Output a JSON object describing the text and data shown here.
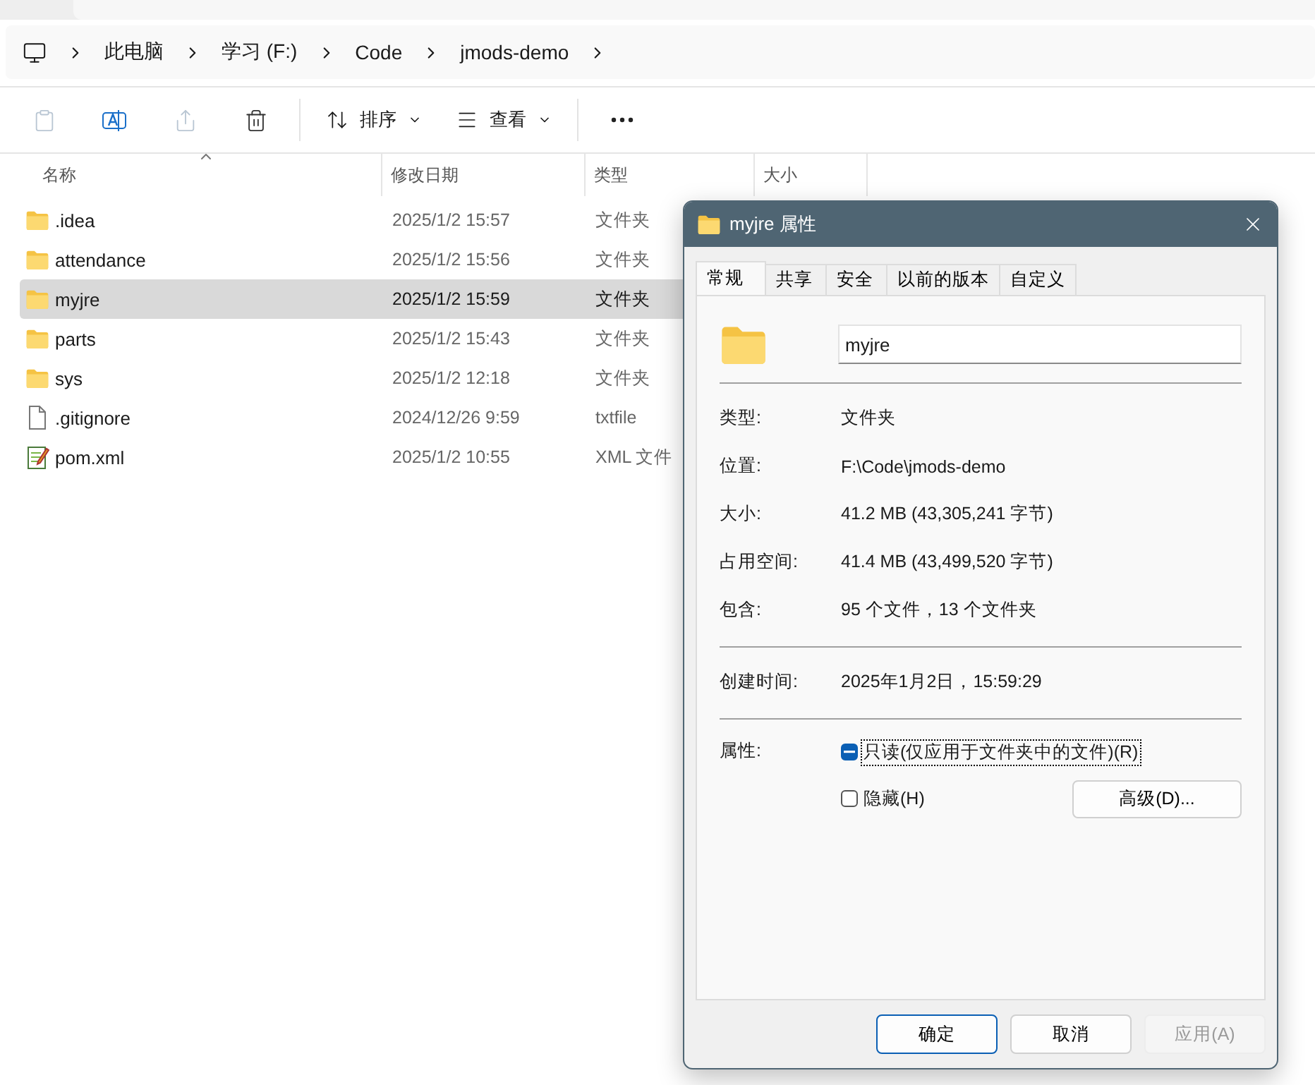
{
  "address": {
    "items": [
      "此电脑",
      "学习 (F:)",
      "Code",
      "jmods-demo"
    ]
  },
  "toolbar": {
    "actions": [
      {
        "kind": "paste",
        "disabled": true
      },
      {
        "kind": "rename",
        "disabled": false
      },
      {
        "kind": "share",
        "disabled": true
      },
      {
        "kind": "delete",
        "disabled": false
      }
    ],
    "sort_label": "排序",
    "view_label": "查看"
  },
  "columns": [
    {
      "label": "名称",
      "sorted": true
    },
    {
      "label": "修改日期",
      "sorted": false
    },
    {
      "label": "类型",
      "sorted": false
    },
    {
      "label": "大小",
      "sorted": false
    }
  ],
  "rows": [
    {
      "name": ".idea",
      "date": "2025/1/2 15:57",
      "type": "文件夹",
      "kind": "folder",
      "selected": false
    },
    {
      "name": "attendance",
      "date": "2025/1/2 15:56",
      "type": "文件夹",
      "kind": "folder",
      "selected": false
    },
    {
      "name": "myjre",
      "date": "2025/1/2 15:59",
      "type": "文件夹",
      "kind": "folder",
      "selected": true
    },
    {
      "name": "parts",
      "date": "2025/1/2 15:43",
      "type": "文件夹",
      "kind": "folder",
      "selected": false
    },
    {
      "name": "sys",
      "date": "2025/1/2 12:18",
      "type": "文件夹",
      "kind": "folder",
      "selected": false
    },
    {
      "name": ".gitignore",
      "date": "2024/12/26 9:59",
      "type": "txtfile",
      "kind": "file",
      "selected": false
    },
    {
      "name": "pom.xml",
      "date": "2025/1/2 10:55",
      "type": "XML 文件",
      "kind": "xml",
      "selected": false
    }
  ],
  "dialog": {
    "title": "myjre 属性",
    "tabs": [
      {
        "label": "常规",
        "selected": true
      },
      {
        "label": "共享",
        "selected": false
      },
      {
        "label": "安全",
        "selected": false
      },
      {
        "label": "以前的版本",
        "selected": false
      },
      {
        "label": "自定义",
        "selected": false
      }
    ],
    "name_value": "myjre",
    "groups": [
      [
        {
          "label": "类型:",
          "value": "文件夹"
        },
        {
          "label": "位置:",
          "value": "F:\\Code\\jmods-demo"
        },
        {
          "label": "大小:",
          "value": "41.2 MB (43,305,241 字节)"
        },
        {
          "label": "占用空间:",
          "value": "41.4 MB (43,499,520 字节)"
        },
        {
          "label": "包含:",
          "value": "95 个文件，13 个文件夹"
        }
      ],
      [
        {
          "label": "创建时间:",
          "value": "2025年1月2日，15:59:29"
        }
      ]
    ],
    "attributes_label": "属性:",
    "checkboxes": [
      {
        "label": "只读(仅应用于文件夹中的文件)(R)",
        "mixed": true,
        "focused": true
      },
      {
        "label": "隐藏(H)",
        "mixed": false,
        "focused": false
      }
    ],
    "advanced_button": "高级(D)...",
    "buttons": [
      {
        "label": "确定",
        "default": true,
        "disabled": false
      },
      {
        "label": "取消",
        "default": false,
        "disabled": false
      },
      {
        "label": "应用(A)",
        "default": false,
        "disabled": true
      }
    ]
  }
}
